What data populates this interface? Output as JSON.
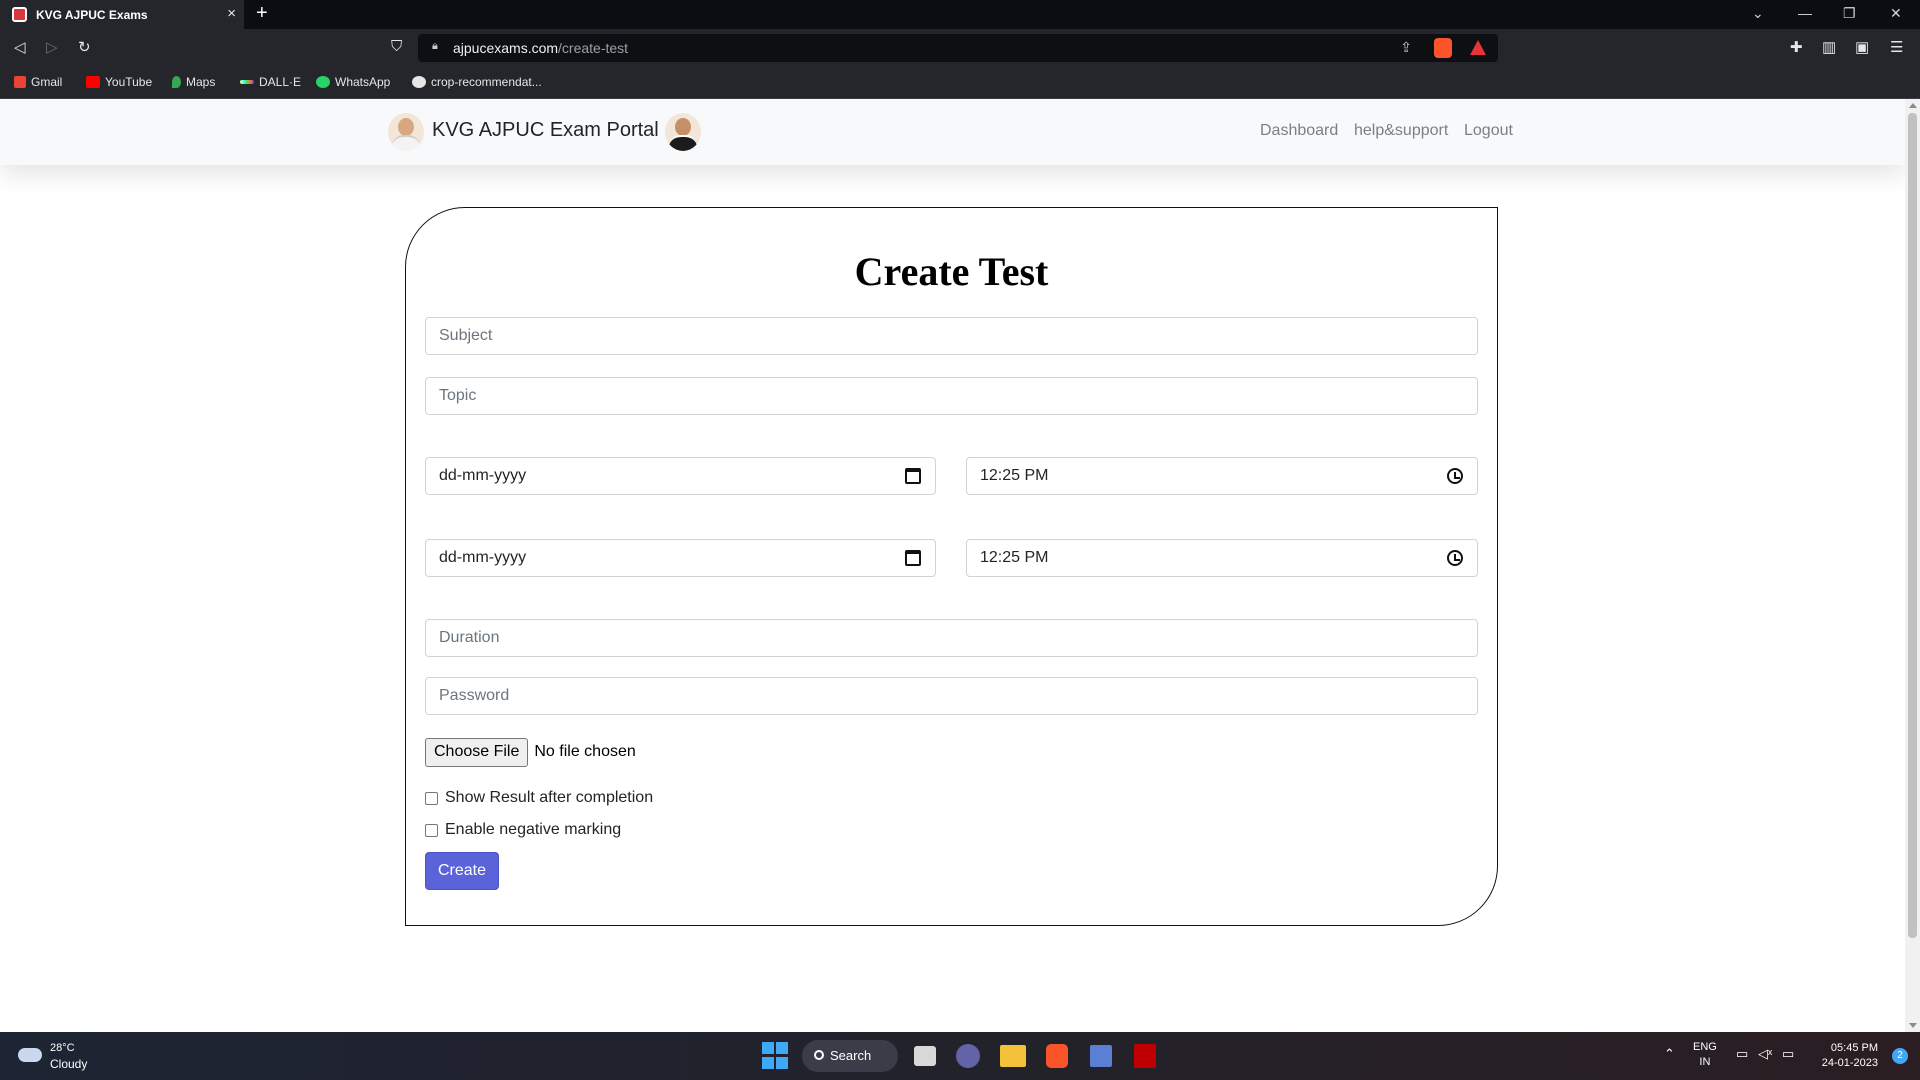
{
  "browser": {
    "tab_title": "KVG AJPUC Exams",
    "tab_close": "×",
    "new_tab": "+",
    "url_host": "ajpucexams.com",
    "url_path": "/create-test",
    "bookmarks": [
      "Gmail",
      "YouTube",
      "Maps",
      "DALL·E",
      "WhatsApp",
      "crop-recommendat..."
    ]
  },
  "site": {
    "brand": "KVG AJPUC Exam Portal",
    "nav": [
      "Dashboard",
      "help&support",
      "Logout"
    ]
  },
  "form": {
    "title": "Create Test",
    "subject_placeholder": "Subject",
    "topic_placeholder": "Topic",
    "start_date": "dd-mm-yyyy",
    "start_time": "12:25 PM",
    "end_date": "dd-mm-yyyy",
    "end_time": "12:25 PM",
    "duration_placeholder": "Duration",
    "password_placeholder": "Password",
    "file_button": "Choose File",
    "file_status": "No file chosen",
    "show_result_label": "Show Result after completion",
    "negative_marking_label": "Enable negative marking",
    "submit_label": "Create"
  },
  "taskbar": {
    "temperature": "28°C",
    "condition": "Cloudy",
    "search_label": "Search",
    "lang_top": "ENG",
    "lang_bottom": "IN",
    "time": "05:45 PM",
    "date": "24-01-2023",
    "notifications": "2"
  }
}
